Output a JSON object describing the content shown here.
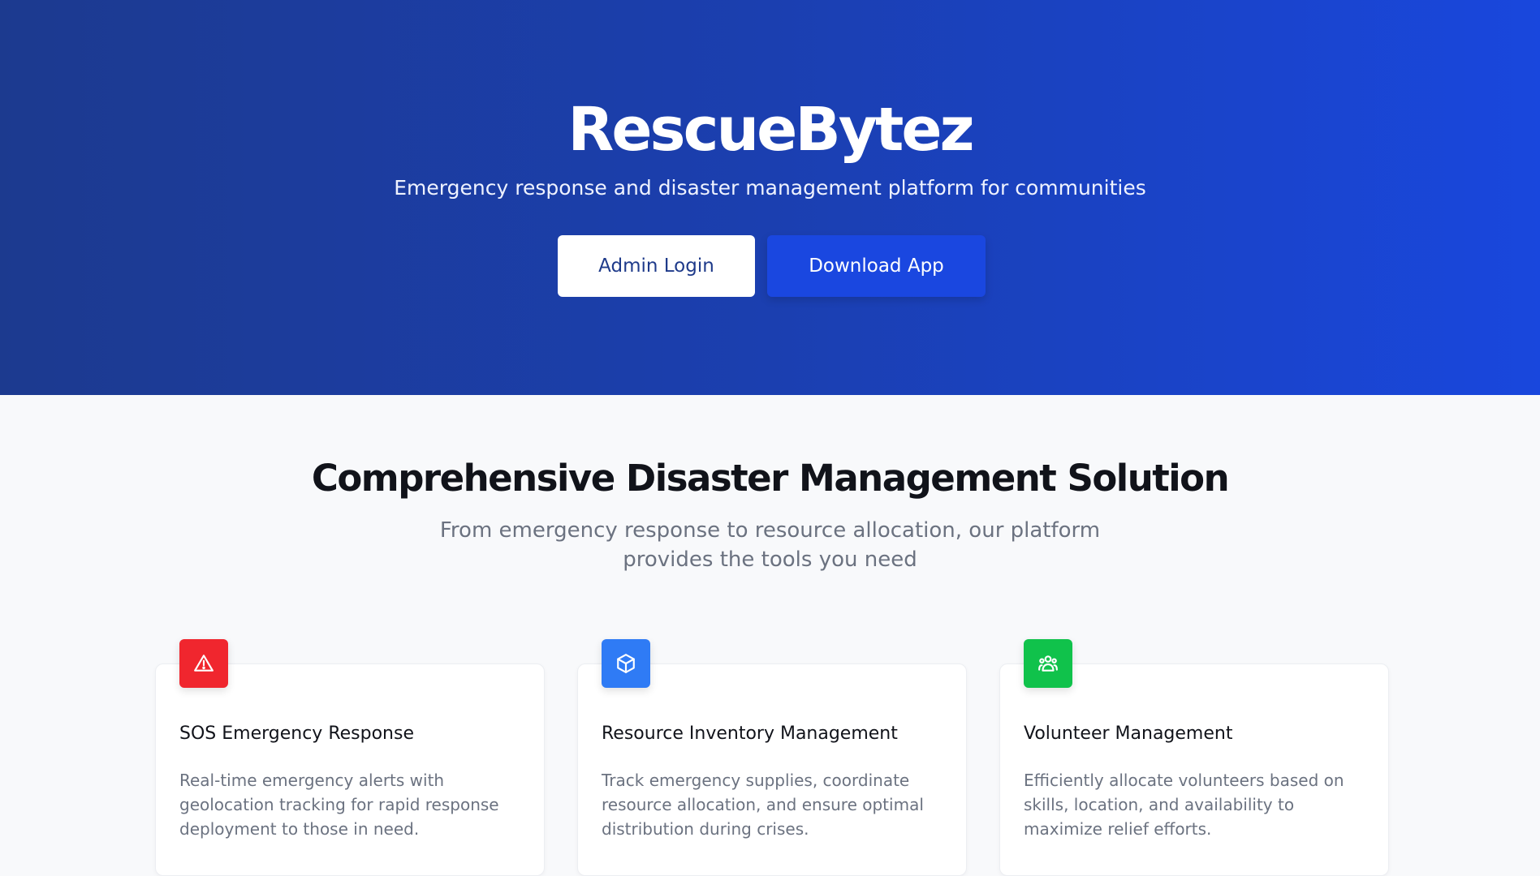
{
  "hero": {
    "title": "RescueBytez",
    "subtitle": "Emergency response and disaster management platform for communities",
    "admin_login_label": "Admin Login",
    "download_app_label": "Download App"
  },
  "features": {
    "title": "Comprehensive Disaster Management Solution",
    "subtitle": "From emergency response to resource allocation, our platform provides the tools you need",
    "cards": [
      {
        "icon": "warning-triangle-icon",
        "icon_color": "#f0262e",
        "title": "SOS Emergency Response",
        "description": "Real-time emergency alerts with geolocation tracking for rapid response deployment to those in need."
      },
      {
        "icon": "cube-icon",
        "icon_color": "#2f7bf5",
        "title": "Resource Inventory Management",
        "description": "Track emergency supplies, coordinate resource allocation, and ensure optimal distribution during crises."
      },
      {
        "icon": "users-group-icon",
        "icon_color": "#10c24b",
        "title": "Volunteer Management",
        "description": "Efficiently allocate volunteers based on skills, location, and availability to maximize relief efforts."
      }
    ]
  },
  "colors": {
    "hero_gradient_start": "#1c3a8f",
    "hero_gradient_end": "#1947dd",
    "primary_button": "#1a47e0",
    "page_background": "#f8f9fb"
  }
}
